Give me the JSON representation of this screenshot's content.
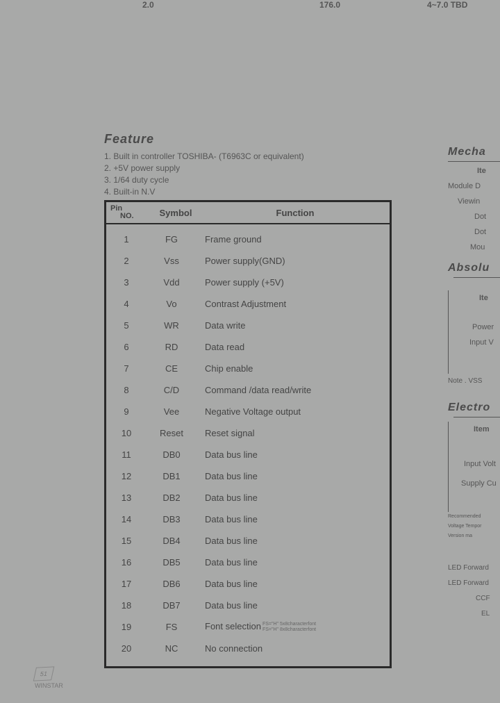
{
  "top_fragments": {
    "a": "2.0",
    "b": "176.0",
    "c": "4~7.0 TBD"
  },
  "feature": {
    "title": "Feature",
    "lines": [
      "1. Built in controller TOSHIBA- (T6963C or equivalent)",
      "2. +5V power supply",
      "3. 1/64 duty cycle",
      "4. Built-in N.V"
    ]
  },
  "pin_table": {
    "headers": {
      "no_l1": "Pin",
      "no_l2": "NO.",
      "symbol": "Symbol",
      "function": "Function"
    },
    "rows": [
      {
        "no": "1",
        "sym": "FG",
        "func": "Frame ground"
      },
      {
        "no": "2",
        "sym": "Vss",
        "func": "Power supply(GND)"
      },
      {
        "no": "3",
        "sym": "Vdd",
        "func": "Power supply (+5V)"
      },
      {
        "no": "4",
        "sym": "Vo",
        "func": "Contrast Adjustment"
      },
      {
        "no": "5",
        "sym": "WR",
        "func": "Data write"
      },
      {
        "no": "6",
        "sym": "RD",
        "func": "Data read"
      },
      {
        "no": "7",
        "sym": "CE",
        "func": "Chip enable"
      },
      {
        "no": "8",
        "sym": "C/D",
        "func": "Command /data  read/write"
      },
      {
        "no": "9",
        "sym": "Vee",
        "func": "Negative Voltage output"
      },
      {
        "no": "10",
        "sym": "Reset",
        "func": "Reset signal"
      },
      {
        "no": "11",
        "sym": "DB0",
        "func": "Data bus line"
      },
      {
        "no": "12",
        "sym": "DB1",
        "func": "Data bus line"
      },
      {
        "no": "13",
        "sym": "DB2",
        "func": "Data bus line"
      },
      {
        "no": "14",
        "sym": "DB3",
        "func": "Data bus line"
      },
      {
        "no": "15",
        "sym": "DB4",
        "func": "Data bus line"
      },
      {
        "no": "16",
        "sym": "DB5",
        "func": "Data bus line"
      },
      {
        "no": "17",
        "sym": "DB6",
        "func": "Data bus line"
      },
      {
        "no": "18",
        "sym": "DB7",
        "func": "Data bus line"
      },
      {
        "no": "19",
        "sym": "FS",
        "func": "Font selection",
        "note1": "FS=\"H\" 5x8characterfont",
        "note2": "FS=\"H\" 8x8characterfont"
      },
      {
        "no": "20",
        "sym": "NC",
        "func": "No connection"
      }
    ]
  },
  "right": {
    "mech_title": "Mecha",
    "mech_items": [
      "Ite",
      "Module D",
      "Viewin",
      "Dot",
      "Dot",
      "Mou"
    ],
    "abs_title": "Absolu",
    "abs_items": [
      "Ite",
      "Power",
      "Input V"
    ],
    "abs_note": "Note . VSS",
    "elec_title": "Electro",
    "elec_items": [
      "Item",
      "Input Volt",
      "Supply Cu"
    ],
    "elec_small": [
      "Recommended",
      "Voltage Tempor",
      "Version ma"
    ],
    "elec_items2": [
      "LED Forward",
      "LED Forward",
      "CCF",
      "EL"
    ]
  },
  "watermark": {
    "num": "51",
    "text": "WINSTAR"
  }
}
